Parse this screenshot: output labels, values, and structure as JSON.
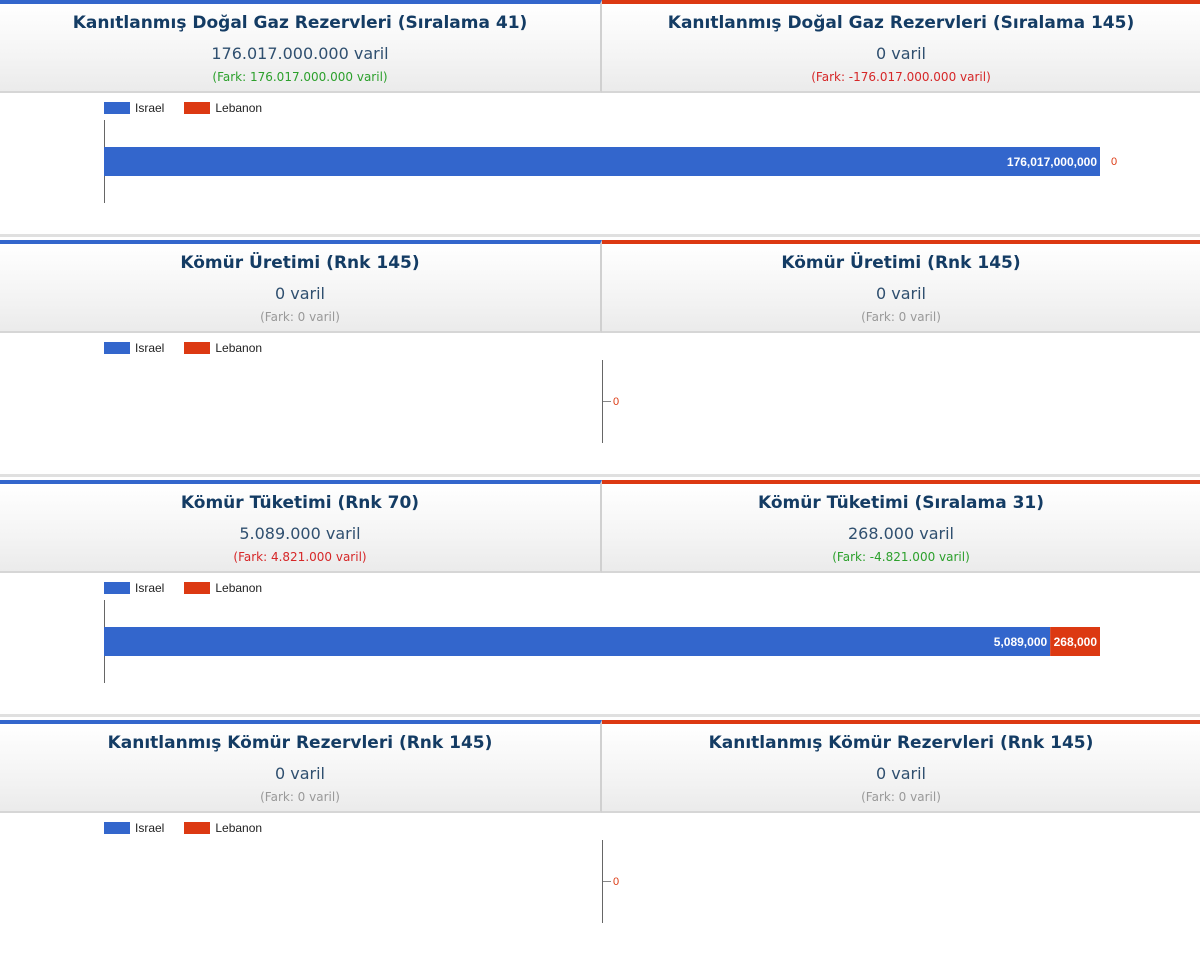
{
  "legend": [
    {
      "name": "Israel",
      "color": "#3366cc"
    },
    {
      "name": "Lebanon",
      "color": "#dc3912"
    }
  ],
  "sections": [
    {
      "left": {
        "title": "Kanıtlanmış Doğal Gaz Rezervleri (Sıralama 41)",
        "value": "176.017.000.000 varil",
        "diff": "(Fark: 176.017.000.000 varil)",
        "diff_type": "pos"
      },
      "right": {
        "title": "Kanıtlanmış Doğal Gaz Rezervleri (Sıralama 145)",
        "value": "0 varil",
        "diff": "(Fark: -176.017.000.000 varil)",
        "diff_type": "neg"
      }
    },
    {
      "left": {
        "title": "Kömür Üretimi (Rnk 145)",
        "value": "0 varil",
        "diff": "(Fark: 0 varil)",
        "diff_type": "neutral"
      },
      "right": {
        "title": "Kömür Üretimi (Rnk 145)",
        "value": "0 varil",
        "diff": "(Fark: 0 varil)",
        "diff_type": "neutral"
      }
    },
    {
      "left": {
        "title": "Kömür Tüketimi (Rnk 70)",
        "value": "5.089.000 varil",
        "diff": "(Fark: 4.821.000 varil)",
        "diff_type": "neg"
      },
      "right": {
        "title": "Kömür Tüketimi (Sıralama 31)",
        "value": "268.000 varil",
        "diff": "(Fark: -4.821.000 varil)",
        "diff_type": "pos"
      }
    },
    {
      "left": {
        "title": "Kanıtlanmış Kömür Rezervleri (Rnk 145)",
        "value": "0 varil",
        "diff": "(Fark: 0 varil)",
        "diff_type": "neutral"
      },
      "right": {
        "title": "Kanıtlanmış Kömür Rezervleri (Rnk 145)",
        "value": "0 varil",
        "diff": "(Fark: 0 varil)",
        "diff_type": "neutral"
      }
    }
  ],
  "chart_data": [
    {
      "type": "bar",
      "orientation": "horizontal",
      "stacked": true,
      "series": [
        {
          "name": "Israel",
          "values": [
            176017000000
          ],
          "labels": [
            "176,017,000,000"
          ]
        },
        {
          "name": "Lebanon",
          "values": [
            0
          ],
          "labels": [
            "0"
          ]
        }
      ]
    },
    {
      "type": "bar",
      "orientation": "horizontal",
      "stacked": true,
      "series": [
        {
          "name": "Israel",
          "values": [
            0
          ],
          "labels": [
            "0"
          ]
        },
        {
          "name": "Lebanon",
          "values": [
            0
          ],
          "labels": [
            "0"
          ]
        }
      ]
    },
    {
      "type": "bar",
      "orientation": "horizontal",
      "stacked": true,
      "series": [
        {
          "name": "Israel",
          "values": [
            5089000
          ],
          "labels": [
            "5,089,000"
          ]
        },
        {
          "name": "Lebanon",
          "values": [
            268000
          ],
          "labels": [
            "268,000"
          ]
        }
      ]
    },
    {
      "type": "bar",
      "orientation": "horizontal",
      "stacked": true,
      "series": [
        {
          "name": "Israel",
          "values": [
            0
          ],
          "labels": [
            "0"
          ]
        },
        {
          "name": "Lebanon",
          "values": [
            0
          ],
          "labels": [
            "0"
          ]
        }
      ]
    }
  ]
}
